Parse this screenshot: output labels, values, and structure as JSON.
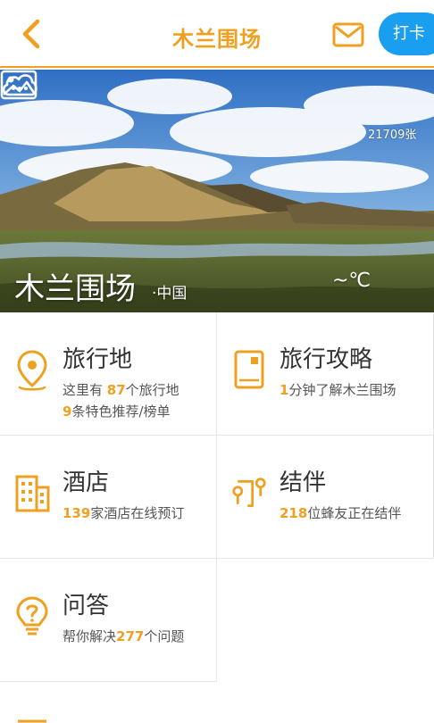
{
  "header": {
    "title": "木兰围场",
    "checkin_label": "打卡"
  },
  "hero": {
    "photo_count": "21709张",
    "place_name": "木兰围场",
    "country": "·中国",
    "temperature": "~℃",
    "weather_icon": "cloud-icon",
    "photo_icon": "image-icon"
  },
  "cards": {
    "destinations": {
      "title": "旅行地",
      "line1_pre": "这里有 ",
      "line1_num": "87",
      "line1_post": "个旅行地",
      "line2_num": "9",
      "line2_post": "条特色推荐/榜单",
      "icon": "location-pin-icon"
    },
    "guides": {
      "title": "旅行攻略",
      "line1_num": "1",
      "line1_post": "分钟了解木兰围场",
      "icon": "guidebook-icon"
    },
    "hotels": {
      "title": "酒店",
      "line1_num": "139",
      "line1_post": "家酒店在线预订",
      "icon": "hotel-building-icon"
    },
    "companions": {
      "title": "结伴",
      "line1_num": "218",
      "line1_post": "位蜂友正在结伴",
      "icon": "route-icon"
    },
    "qa": {
      "title": "问答",
      "line1_pre": "帮你解决",
      "line1_num": "277",
      "line1_post": "个问题",
      "icon": "lightbulb-question-icon"
    }
  },
  "colors": {
    "accent": "#f0a020",
    "checkin_bg": "#1a9ef0",
    "divider": "#e6e6e6"
  }
}
